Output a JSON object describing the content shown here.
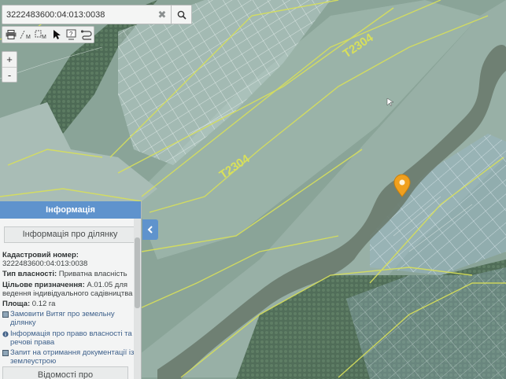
{
  "search": {
    "value": "3222483600:04:013:0038"
  },
  "toolbar": {
    "tools": [
      {
        "name": "print-tool",
        "icon": "printer-icon"
      },
      {
        "name": "measure-line-tool",
        "icon": "measure-line-icon",
        "glyph": "M"
      },
      {
        "name": "measure-area-tool",
        "icon": "measure-area-icon",
        "glyph": "M"
      },
      {
        "name": "select-tool",
        "icon": "cursor-icon"
      },
      {
        "name": "info-tool",
        "icon": "info-query-icon",
        "glyph": "?"
      },
      {
        "name": "route-tool",
        "icon": "route-icon"
      }
    ]
  },
  "zoom": {
    "in_label": "+",
    "out_label": "-"
  },
  "map": {
    "road_labels": [
      "Т2304",
      "Т2304"
    ]
  },
  "panel": {
    "title": "Інформація",
    "subtitle": "Інформація про ділянку",
    "cadastral_label": "Кадастровий номер:",
    "cadastral_value": "3222483600:04:013:0038",
    "ownership_label": "Тип власності:",
    "ownership_value": "Приватна власність",
    "purpose_label": "Цільове призначення:",
    "purpose_value": "A.01.05 для ведення індивідуального садівництва",
    "area_label": "Площа:",
    "area_value": "0.12 га",
    "links": [
      {
        "label": "Замовити Витяг про земельну ділянку",
        "icon": "document-icon"
      },
      {
        "label": "Інформація про право власності та речові права",
        "icon": "info-circle-icon"
      },
      {
        "label": "Запит на отримання документації із землеустрою",
        "icon": "document-icon"
      }
    ],
    "footer_button": "Відомості про сертифікованого"
  },
  "colors": {
    "parcel_outline": "#d8e05a",
    "parcel_fill": "#b9d0d4",
    "panel_header": "#5f93cd",
    "marker": "#f0a01e"
  }
}
